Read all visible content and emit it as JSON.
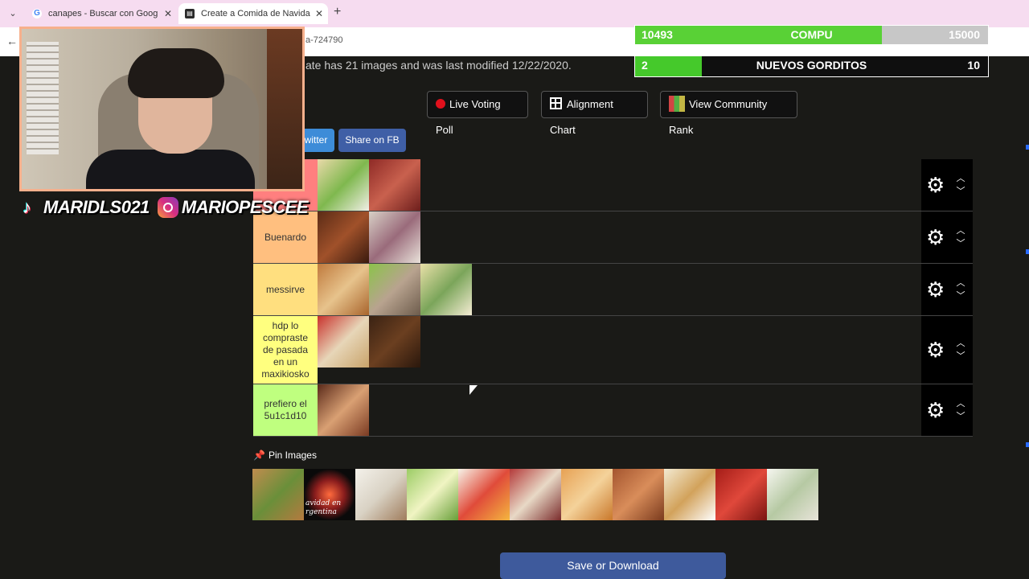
{
  "browser": {
    "tabs": [
      {
        "title": "canapes - Buscar con Google",
        "icon": "google-icon"
      },
      {
        "title": "Create a Comida de Navidad A",
        "icon": "tiermaker-icon"
      }
    ],
    "new_tab": "+",
    "close": "✕",
    "url_fragment": "a-724790"
  },
  "page": {
    "description": "ate has 21 images and was last modified 12/22/2020.",
    "buttons": {
      "live_voting": "Live Voting Poll",
      "alignment": "Alignment Chart",
      "community_rank": "View Community Rank"
    },
    "share": {
      "twitter": "witter",
      "facebook": "Share on FB"
    },
    "tiers": [
      {
        "label": "",
        "color": "#ff7f7f",
        "images": [
          "salad",
          "meat-roll"
        ]
      },
      {
        "label": "Buenardo",
        "color": "#ffbf7f",
        "images": [
          "ribs",
          "wraps"
        ]
      },
      {
        "label": "messirve",
        "color": "#ffdf7f",
        "images": [
          "roll-cake",
          "sausage",
          "sandwich-cake"
        ]
      },
      {
        "label": "hdp lo compraste de pasada en un maxikiosko",
        "color": "#ffff7f",
        "images": [
          "mantecol",
          "coffee-beans"
        ]
      },
      {
        "label": "prefiero el 5u1c1d10",
        "color": "#bfff7f",
        "images": [
          "fruitcake"
        ]
      }
    ],
    "pin_label": "Pin Images",
    "pool": [
      "sandwich",
      "fireworks",
      "turron",
      "salad-green",
      "fruit-salad",
      "nougat",
      "pan-dulce",
      "peanuts",
      "turron-slice",
      "tomato-stuffed",
      "vitel-tone"
    ],
    "pool_caption": "avidad en rgentina",
    "save_label": "Save or Download"
  },
  "overlay": {
    "compu": {
      "current": "10493",
      "label": "COMPU",
      "max": "15000",
      "progress": 0.7
    },
    "gorditos": {
      "current": "2",
      "label": "NUEVOS GORDITOS",
      "max": "10",
      "progress": 0.19
    },
    "tiktok_handle": "MARIDLS021",
    "instagram_handle": "MARIOPESCEE"
  },
  "colors": {
    "accent_blue": "#3e5a9c",
    "progress_green": "#59d136",
    "record_red": "#e0101c"
  }
}
